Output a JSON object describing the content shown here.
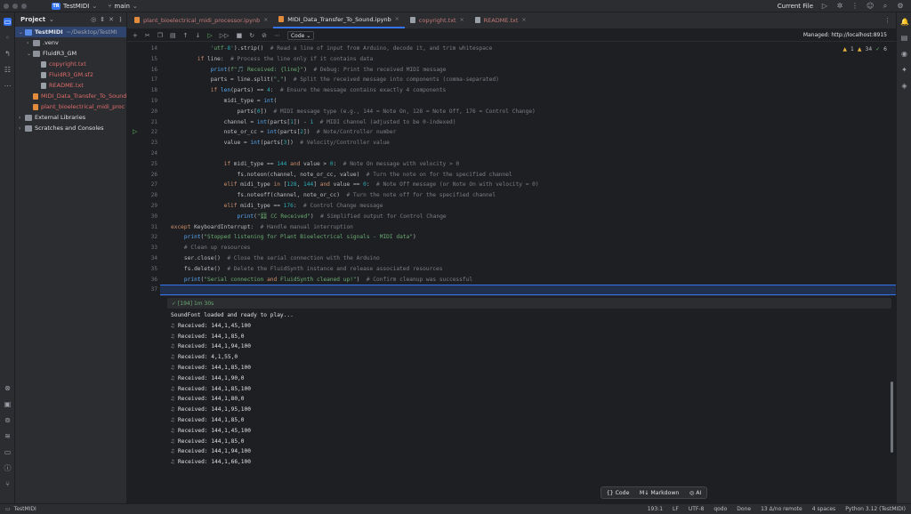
{
  "titlebar": {
    "project_badge": "TR",
    "project_name": "TestMIDI",
    "branch": "main",
    "run_config": "Current File"
  },
  "project_panel": {
    "header": "Project",
    "tree": [
      {
        "label": "TestMIDI",
        "suffix": "~/Desktop/TestMI",
        "indent": 0,
        "kind": "folder-blue",
        "open": true,
        "selected": true
      },
      {
        "label": ".venv",
        "indent": 1,
        "kind": "folder",
        "open": false
      },
      {
        "label": "FluidR3_GM",
        "indent": 1,
        "kind": "folder",
        "open": true
      },
      {
        "label": "copyright.txt",
        "indent": 2,
        "kind": "txt",
        "color": "red"
      },
      {
        "label": "FluidR3_GM.sf2",
        "indent": 2,
        "kind": "sf",
        "color": "red"
      },
      {
        "label": "README.txt",
        "indent": 2,
        "kind": "txt",
        "color": "red"
      },
      {
        "label": "MIDI_Data_Transfer_To_Sound",
        "indent": 1,
        "kind": "nb",
        "color": "red"
      },
      {
        "label": "plant_bioelectrical_midi_proc",
        "indent": 1,
        "kind": "nb",
        "color": "red"
      },
      {
        "label": "External Libraries",
        "indent": 0,
        "kind": "folder",
        "open": false
      },
      {
        "label": "Scratches and Consoles",
        "indent": 0,
        "kind": "folder",
        "open": false
      }
    ]
  },
  "tabs": [
    {
      "label": "plant_bioelectrical_midi_processor.ipynb",
      "kind": "nb",
      "active": false
    },
    {
      "label": "MIDI_Data_Transfer_To_Sound.ipynb",
      "kind": "nb",
      "active": true
    },
    {
      "label": "copyright.txt",
      "kind": "txt",
      "active": false
    },
    {
      "label": "README.txt",
      "kind": "txt",
      "active": false
    }
  ],
  "nb_toolbar": {
    "cell_type": "Code",
    "managed": "Managed: http://localhost:8915"
  },
  "inspections": {
    "warnings": "1",
    "weak": "34",
    "ok": "6"
  },
  "code": {
    "line_numbers": [
      "14",
      "15",
      "16",
      "17",
      "18",
      "19",
      "20",
      "21",
      "22",
      "23",
      "24",
      "25",
      "26",
      "27",
      "28",
      "29",
      "30",
      "31",
      "32",
      "33",
      "34",
      "35",
      "36",
      "37"
    ],
    "lines": [
      "            'utf-8').strip()  # Read a line of input from Arduino, decode it, and trim whitespace",
      "        if line:  # Process the line only if it contains data",
      "            print(f\"🎵 Received: {line}\")  # Debug: Print the received MIDI message",
      "            parts = line.split(\",\")  # Split the received message into components (comma-separated)",
      "            if len(parts) == 4:  # Ensure the message contains exactly 4 components",
      "                midi_type = int(",
      "                    parts[0])  # MIDI message type (e.g., 144 = Note On, 128 = Note Off, 176 = Control Change)",
      "                channel = int(parts[1]) - 1  # MIDI channel (adjusted to be 0-indexed)",
      "                note_or_cc = int(parts[2])  # Note/Controller number",
      "                value = int(parts[3])  # Velocity/Controller value",
      "",
      "                if midi_type == 144 and value > 0:  # Note On message with velocity > 0",
      "                    fs.noteon(channel, note_or_cc, value)  # Turn the note on for the specified channel",
      "                elif midi_type in [128, 144] and value == 0:  # Note Off message (or Note On with velocity = 0)",
      "                    fs.noteoff(channel, note_or_cc)  # Turn the note off for the specified channel",
      "                elif midi_type == 176:  # Control Change message",
      "                    print(\"🎛 CC Received\")  # Simplified output for Control Change",
      "except KeyboardInterrupt:  # Handle manual interruption",
      "    print(\"Stopped listening for Plant Bioelectrical signals - MIDI data\")",
      "    # Clean up resources",
      "    ser.close()  # Close the serial connection with the Arduino",
      "    fs.delete()  # Delete the FluidSynth instance and release associated resources",
      "    print(\"Serial connection and FluidSynth cleaned up!\")  # Confirm cleanup was successful",
      ""
    ]
  },
  "output": {
    "exec_label": "✓ [194] 1m 30s",
    "first_line": "SoundFont loaded and ready to play...",
    "received": [
      "Received: 144,1,45,100",
      "Received: 144,1,85,0",
      "Received: 144,1,94,100",
      "Received: 4,1,55,0",
      "Received: 144,1,85,100",
      "Received: 144,1,90,0",
      "Received: 144,1,85,100",
      "Received: 144,1,80,0",
      "Received: 144,1,95,100",
      "Received: 144,1,85,0",
      "Received: 144,1,45,100",
      "Received: 144,1,85,0",
      "Received: 144,1,94,100",
      "Received: 144,1,66,100"
    ]
  },
  "addbar": {
    "code": "Code",
    "markdown": "Markdown",
    "ai": "AI"
  },
  "statusbar": {
    "project": "TestMIDI",
    "position": "193:1",
    "line_sep": "LF",
    "encoding": "UTF-8",
    "qodo": "qodo",
    "done": "Done",
    "vcs": "13 Δ/no remote",
    "indent": "4 spaces",
    "interpreter": "Python 3.12 (TestMIDI)"
  }
}
